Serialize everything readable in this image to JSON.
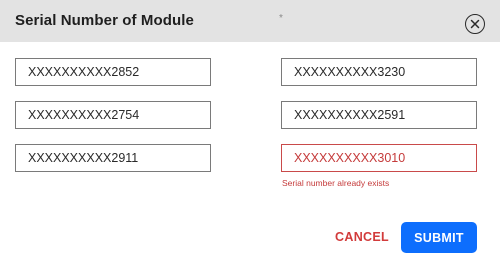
{
  "modal": {
    "title": "Serial Number of Module",
    "close_icon": "close-circle-icon",
    "stray_mark": "*"
  },
  "fields": [
    {
      "value": "XXXXXXXXXX2852",
      "state": "normal"
    },
    {
      "value": "XXXXXXXXXX3230",
      "state": "normal"
    },
    {
      "value": "XXXXXXXXXX2754",
      "state": "normal"
    },
    {
      "value": "XXXXXXXXXX2591",
      "state": "normal"
    },
    {
      "value": "XXXXXXXXXX2911",
      "state": "normal"
    },
    {
      "value": "XXXXXXXXXX3010",
      "state": "error"
    }
  ],
  "error_message": "Serial number already exists",
  "actions": {
    "cancel_label": "CANCEL",
    "submit_label": "SUBMIT"
  },
  "colors": {
    "header_bg": "#e3e3e3",
    "error": "#c53b3b",
    "cancel_text": "#d23b3b",
    "submit_bg": "#0d6efd"
  }
}
